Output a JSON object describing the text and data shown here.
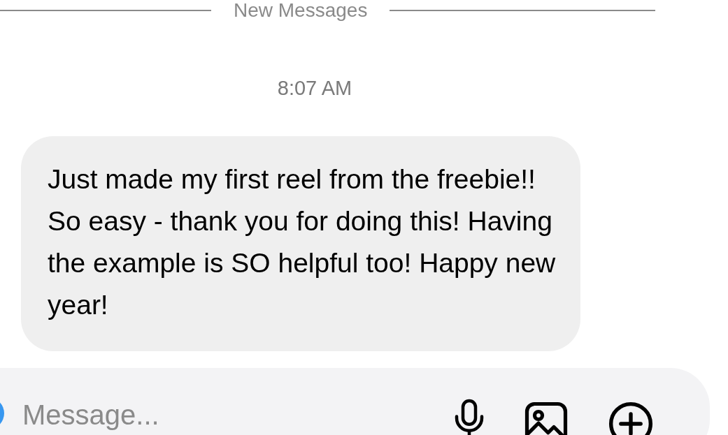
{
  "divider": {
    "label": "New Messages"
  },
  "timestamp": "8:07 AM",
  "messages": [
    {
      "text": "Just made my first reel from the freebie!! So easy - thank you for doing this! Having the example is SO helpful too! Happy new year!"
    }
  ],
  "composer": {
    "placeholder": "Message..."
  }
}
